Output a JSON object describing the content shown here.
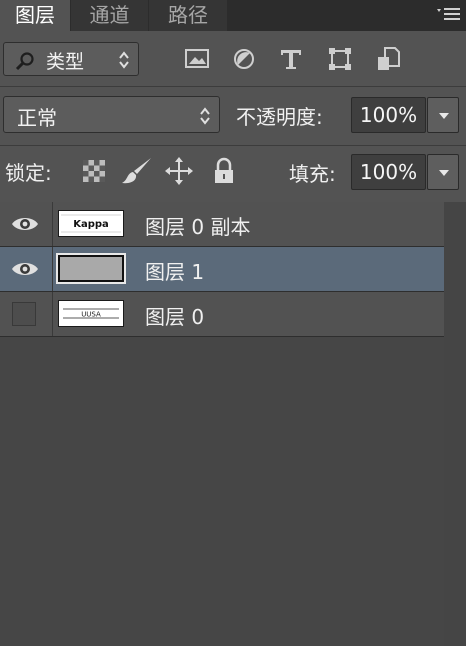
{
  "tabs": [
    {
      "label": "图层",
      "active": true
    },
    {
      "label": "通道",
      "active": false
    },
    {
      "label": "路径",
      "active": false
    }
  ],
  "filter": {
    "kind_label": "类型",
    "icons": [
      "image-filter-icon",
      "adjustment-filter-icon",
      "type-filter-icon",
      "shape-filter-icon",
      "smart-object-filter-icon"
    ]
  },
  "blend": {
    "mode": "正常",
    "opacity_label": "不透明度:",
    "opacity_value": "100%"
  },
  "lock": {
    "label": "锁定:",
    "icons": [
      "lock-transparent-pixels-icon",
      "lock-image-pixels-icon",
      "lock-position-icon",
      "lock-all-icon"
    ],
    "fill_label": "填充:",
    "fill_value": "100%"
  },
  "layers": [
    {
      "name": "图层 0 副本",
      "visible": true,
      "selected": false
    },
    {
      "name": "图层 1",
      "visible": true,
      "selected": true
    },
    {
      "name": "图层 0",
      "visible": false,
      "selected": false
    }
  ],
  "thumbnails": {
    "copy_text": "Kappa",
    "base_text": "UUSA"
  },
  "colors": {
    "panel_bg": "#535353",
    "list_bg": "#464646",
    "selected_row": "#5b6a7a",
    "tab_bar": "#2c2c2c"
  }
}
